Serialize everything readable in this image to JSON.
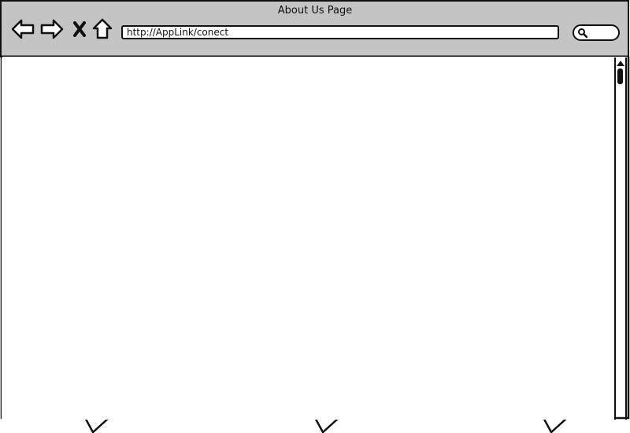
{
  "window": {
    "title": "About Us Page"
  },
  "toolbar": {
    "back_icon": "back-arrow-icon",
    "forward_icon": "forward-arrow-icon",
    "stop_icon": "close-icon",
    "home_icon": "home-icon"
  },
  "address_bar": {
    "url": "http://AppLink/conect"
  },
  "search": {
    "icon": "search-icon",
    "value": ""
  },
  "colors": {
    "chrome": "#c4c4c4",
    "border": "#111111",
    "page": "#ffffff"
  }
}
